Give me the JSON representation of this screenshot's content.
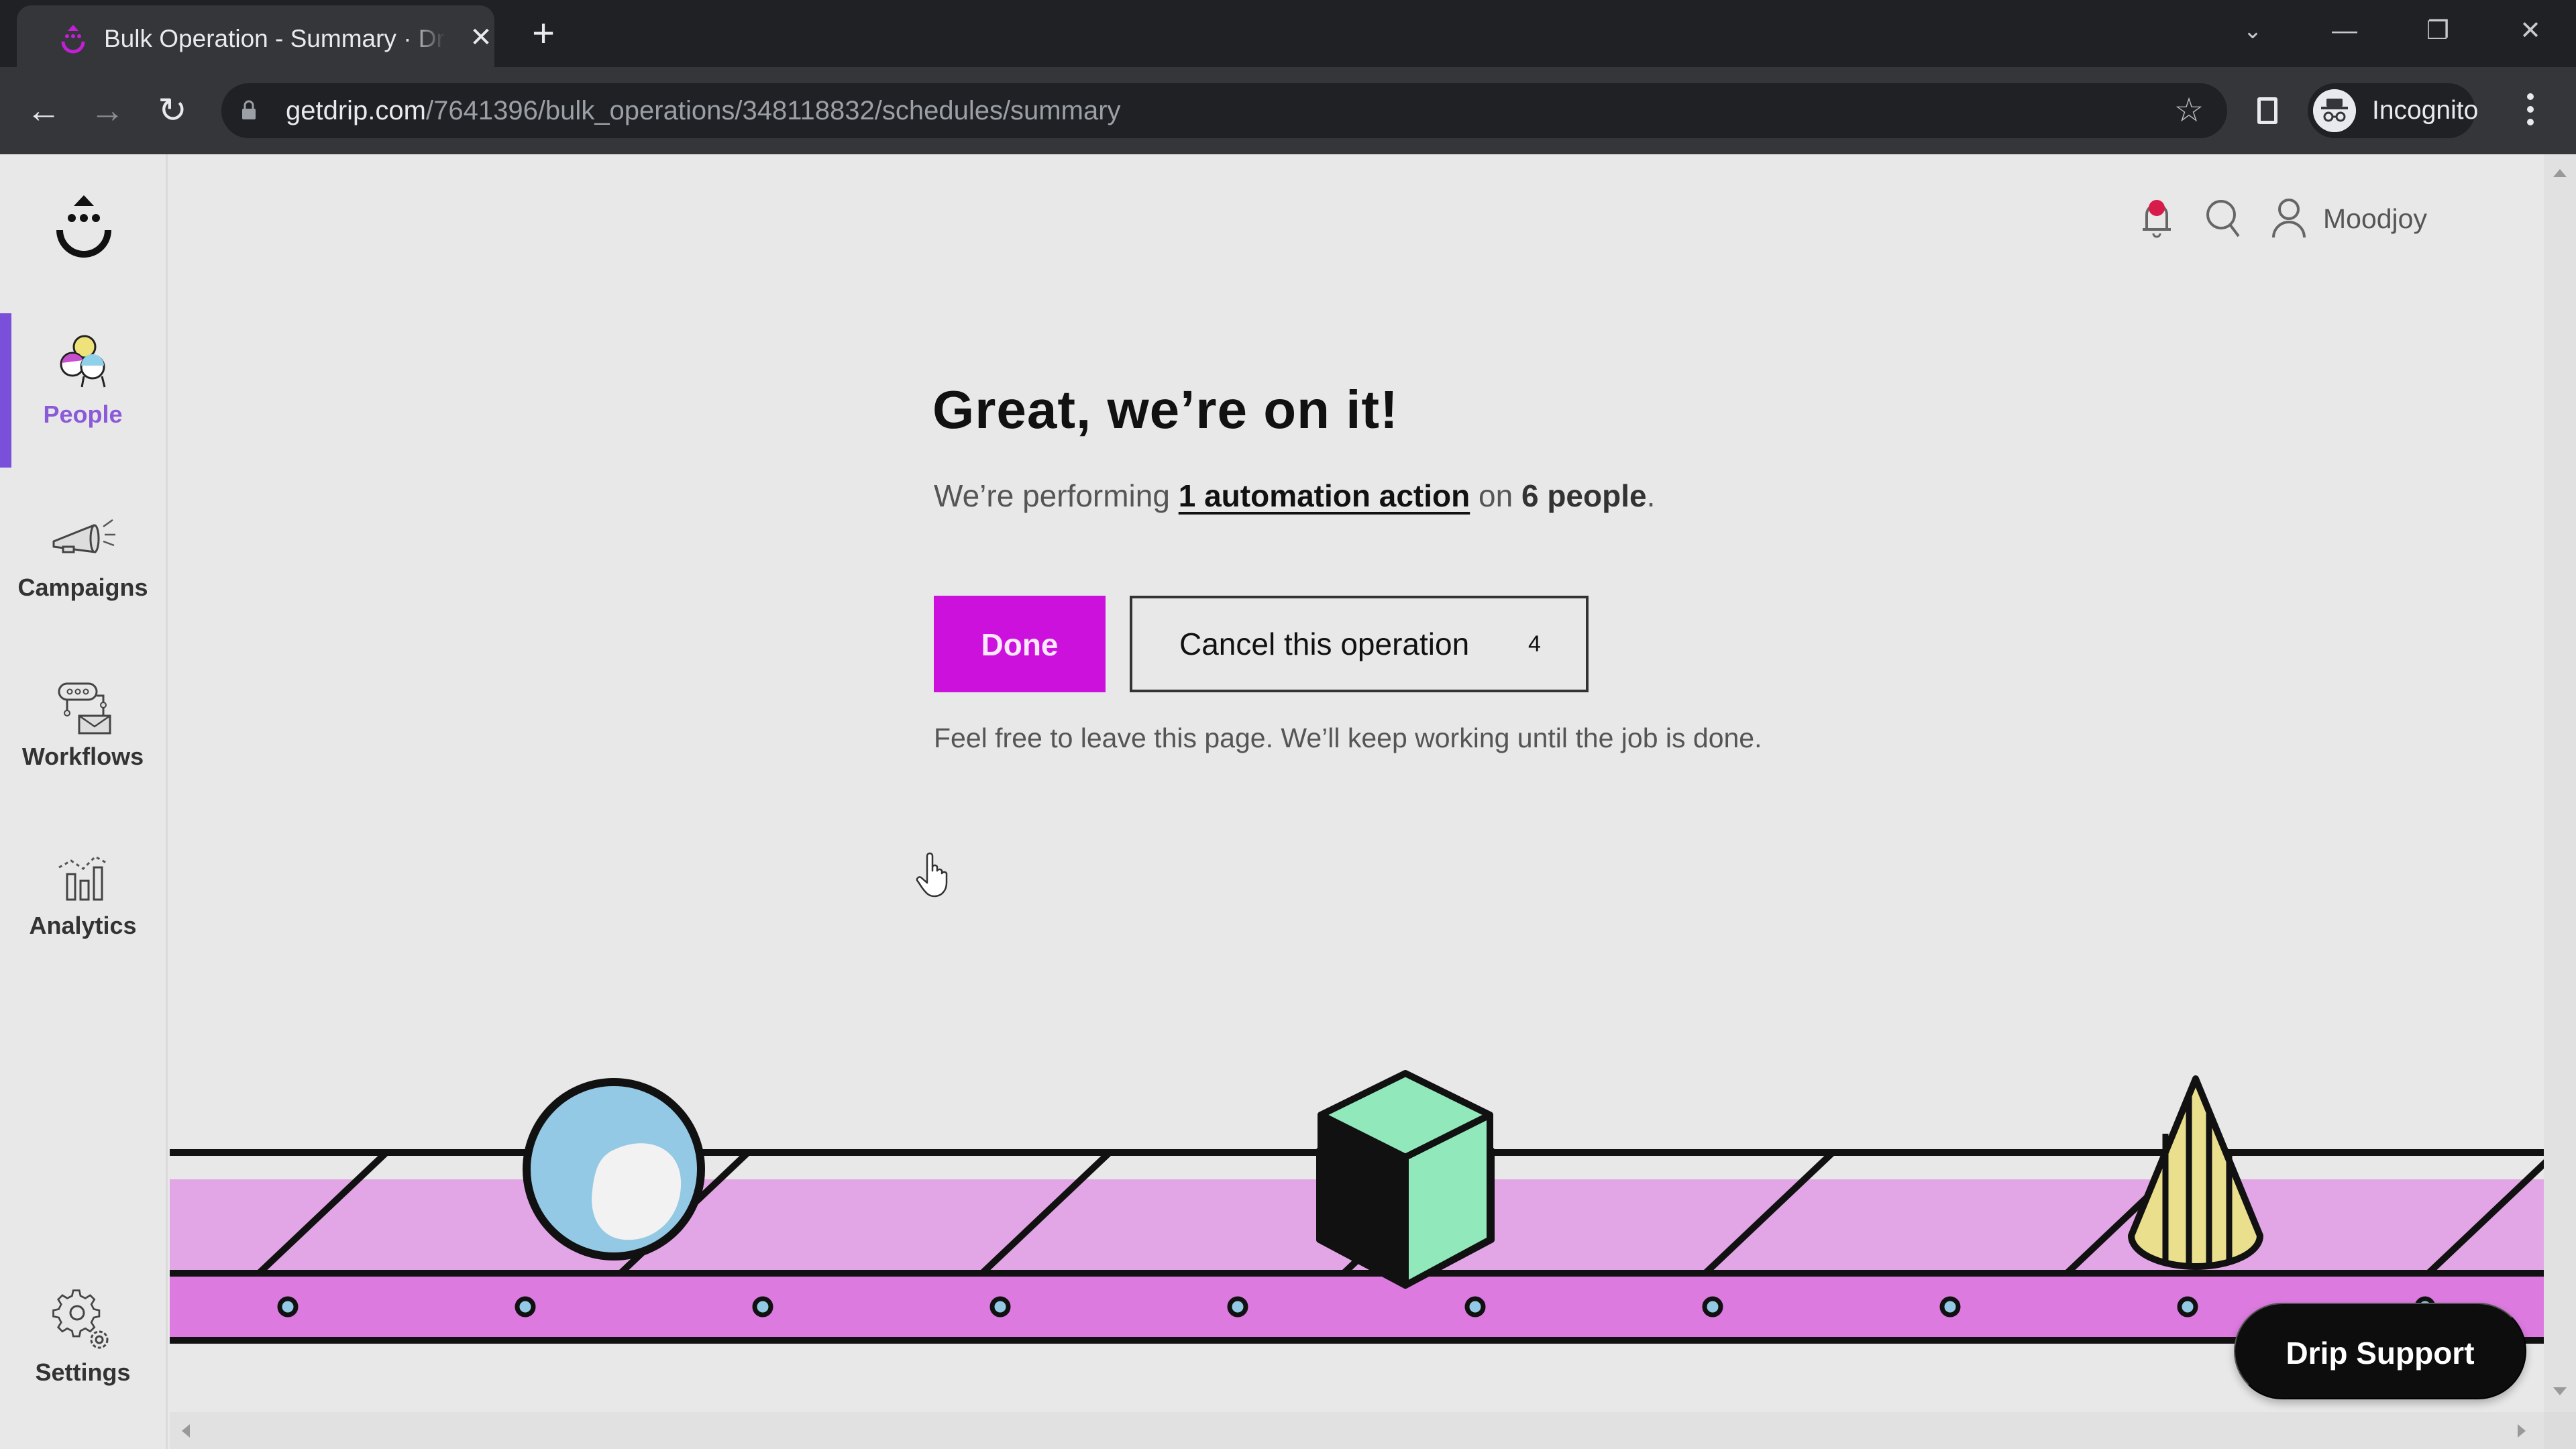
{
  "browser": {
    "tab_title": "Bulk Operation - Summary · Drip",
    "tab_close": "✕",
    "new_tab": "+",
    "url_host": "getdrip.com",
    "url_path": "/7641396/bulk_operations/348118832/schedules/summary",
    "profile_label": "Incognito",
    "window_controls": {
      "tab_search": "⌄",
      "minimize": "—",
      "restore": "❐",
      "close": "✕"
    },
    "nav": {
      "back": "←",
      "forward": "→",
      "reload": "↻"
    },
    "bookmark_star": "☆"
  },
  "sidebar": {
    "items": [
      {
        "label": "People",
        "icon": "people-icon",
        "active": true
      },
      {
        "label": "Campaigns",
        "icon": "megaphone-icon",
        "active": false
      },
      {
        "label": "Workflows",
        "icon": "workflow-icon",
        "active": false
      },
      {
        "label": "Analytics",
        "icon": "analytics-icon",
        "active": false
      },
      {
        "label": "Settings",
        "icon": "gear-icon",
        "active": false
      }
    ]
  },
  "header": {
    "username": "Moodjoy",
    "notification_dot": true
  },
  "main": {
    "heading": "Great, we’re on it!",
    "sub_prefix": "We’re performing ",
    "sub_link": "1 automation action",
    "sub_middle": " on ",
    "sub_bold": "6 people",
    "sub_suffix": ".",
    "done_label": "Done",
    "cancel_label": "Cancel this operation",
    "cancel_countdown": "4",
    "note": "Feel free to leave this page. We’ll keep working until the job is done."
  },
  "support": {
    "label": "Drip Support"
  },
  "colors": {
    "accent_magenta": "#cc11dd",
    "active_nav": "#7a4fd9",
    "belt_light": "#e2a6e6",
    "belt_dark": "#dc7ae0",
    "ball": "#93c9e4",
    "cube": "#91e8bb",
    "cone": "#e9df8d",
    "notification": "#d81b4a"
  }
}
